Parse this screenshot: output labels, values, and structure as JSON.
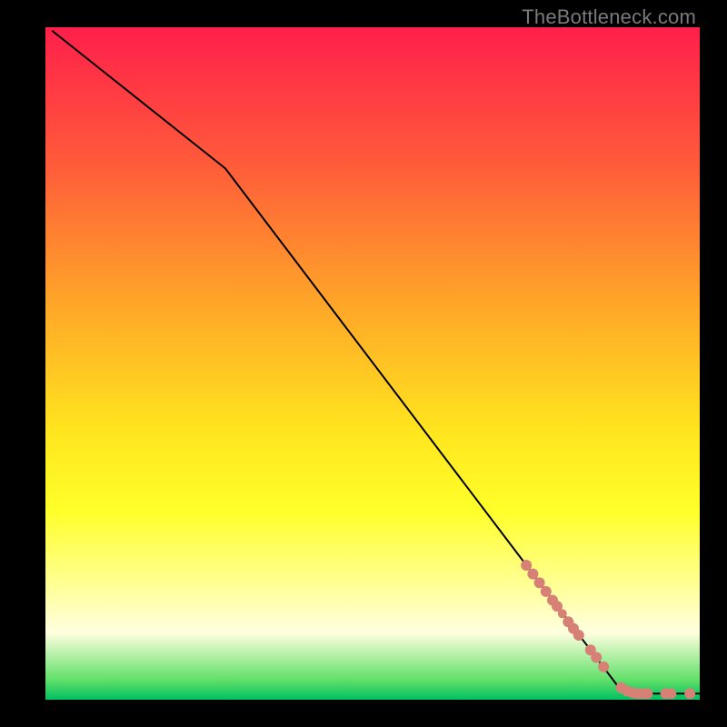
{
  "watermark": "TheBottleneck.com",
  "chart_data": {
    "type": "line",
    "title": "",
    "xlabel": "",
    "ylabel": "",
    "xlim": [
      0,
      100
    ],
    "ylim": [
      0,
      100
    ],
    "grid": false,
    "gradient_stops": [
      {
        "offset": 0.0,
        "color": "#ff1f4b"
      },
      {
        "offset": 0.2,
        "color": "#ff5a3a"
      },
      {
        "offset": 0.4,
        "color": "#ffa229"
      },
      {
        "offset": 0.6,
        "color": "#ffe51e"
      },
      {
        "offset": 0.72,
        "color": "#ffff2a"
      },
      {
        "offset": 0.82,
        "color": "#ffff8c"
      },
      {
        "offset": 0.9,
        "color": "#ffffe0"
      },
      {
        "offset": 0.97,
        "color": "#63e06a"
      },
      {
        "offset": 1.0,
        "color": "#00c060"
      }
    ],
    "line_points": [
      {
        "x": 1.0,
        "y": 99.5
      },
      {
        "x": 27.5,
        "y": 79.0
      },
      {
        "x": 73.5,
        "y": 20.0
      },
      {
        "x": 87.5,
        "y": 2.0
      },
      {
        "x": 88.5,
        "y": 1.4
      },
      {
        "x": 89.5,
        "y": 1.1
      },
      {
        "x": 92.0,
        "y": 0.9
      },
      {
        "x": 95.0,
        "y": 0.9
      },
      {
        "x": 100.0,
        "y": 0.9
      }
    ],
    "markers": [
      {
        "x": 73.5,
        "y": 20.0,
        "r": 6
      },
      {
        "x": 74.5,
        "y": 18.7,
        "r": 6
      },
      {
        "x": 75.5,
        "y": 17.4,
        "r": 6
      },
      {
        "x": 76.5,
        "y": 16.1,
        "r": 6
      },
      {
        "x": 77.5,
        "y": 14.8,
        "r": 6
      },
      {
        "x": 78.2,
        "y": 13.9,
        "r": 6
      },
      {
        "x": 79.0,
        "y": 12.8,
        "r": 5
      },
      {
        "x": 79.9,
        "y": 11.6,
        "r": 6
      },
      {
        "x": 80.7,
        "y": 10.6,
        "r": 6
      },
      {
        "x": 81.5,
        "y": 9.6,
        "r": 6
      },
      {
        "x": 83.3,
        "y": 7.4,
        "r": 6
      },
      {
        "x": 84.2,
        "y": 6.3,
        "r": 6
      },
      {
        "x": 85.3,
        "y": 4.9,
        "r": 6
      },
      {
        "x": 88.0,
        "y": 1.8,
        "r": 6
      },
      {
        "x": 88.9,
        "y": 1.3,
        "r": 6
      },
      {
        "x": 89.8,
        "y": 1.0,
        "r": 6
      },
      {
        "x": 90.5,
        "y": 0.9,
        "r": 6
      },
      {
        "x": 91.3,
        "y": 0.9,
        "r": 6
      },
      {
        "x": 92.0,
        "y": 0.9,
        "r": 6
      },
      {
        "x": 94.8,
        "y": 0.9,
        "r": 6
      },
      {
        "x": 95.6,
        "y": 0.9,
        "r": 6
      },
      {
        "x": 98.5,
        "y": 0.9,
        "r": 6
      }
    ],
    "marker_color": "#d78176",
    "line_color": "#000000",
    "line_width": 2
  }
}
